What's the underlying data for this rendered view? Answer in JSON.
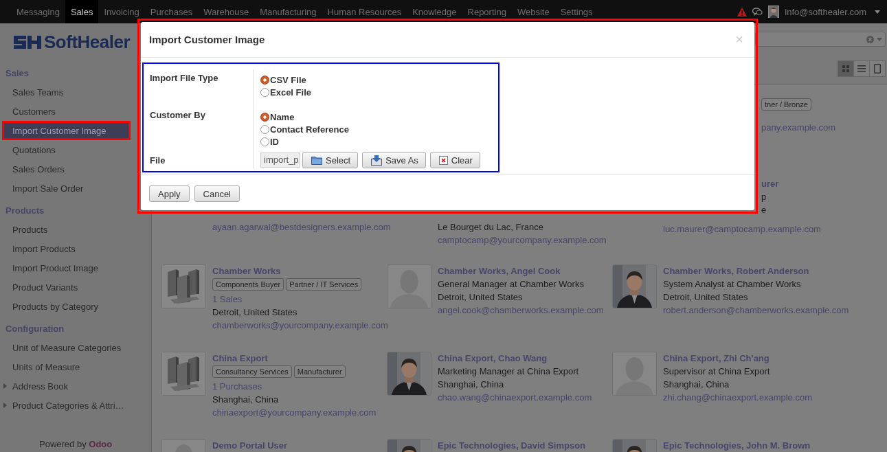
{
  "menu": [
    {
      "label": "Messaging",
      "selected": false
    },
    {
      "label": "Sales",
      "selected": true
    },
    {
      "label": "Invoicing",
      "selected": false
    },
    {
      "label": "Purchases",
      "selected": false
    },
    {
      "label": "Warehouse",
      "selected": false
    },
    {
      "label": "Manufacturing",
      "selected": false
    },
    {
      "label": "Human Resources",
      "selected": false
    },
    {
      "label": "Knowledge",
      "selected": false
    },
    {
      "label": "Reporting",
      "selected": false
    },
    {
      "label": "Website",
      "selected": false
    },
    {
      "label": "Settings",
      "selected": false
    }
  ],
  "user": {
    "email": "info@softhealer.com"
  },
  "sidebar": {
    "logo": "SoftHealer",
    "sections": [
      {
        "title": "Sales",
        "items": [
          {
            "label": "Sales Teams",
            "selected": false
          },
          {
            "label": "Customers",
            "selected": false
          },
          {
            "label": "Import Customer Image",
            "selected": true,
            "highlighted": true
          },
          {
            "label": "Quotations",
            "selected": false
          },
          {
            "label": "Sales Orders",
            "selected": false
          },
          {
            "label": "Import Sale Order",
            "selected": false
          }
        ]
      },
      {
        "title": "Products",
        "items": [
          {
            "label": "Products",
            "selected": false
          },
          {
            "label": "Import Products",
            "selected": false
          },
          {
            "label": "Import Product Image",
            "selected": false
          },
          {
            "label": "Product Variants",
            "selected": false
          },
          {
            "label": "Products by Category",
            "selected": false
          }
        ]
      },
      {
        "title": "Configuration",
        "items": [
          {
            "label": "Unit of Measure Categories",
            "selected": false
          },
          {
            "label": "Units of Measure",
            "selected": false
          },
          {
            "label": "Address Book",
            "selected": false,
            "expanded": false
          },
          {
            "label": "Product Categories & Attri…",
            "selected": false,
            "expanded": false
          }
        ]
      }
    ],
    "footer": "Powered by **Odoo**"
  },
  "views": [
    {
      "kind": "kanban",
      "selected": true
    },
    {
      "kind": "list",
      "selected": false
    },
    {
      "kind": "form",
      "selected": false
    }
  ],
  "rows": [
    {
      "cards": [
        {
          "kind": "covered",
          "side_lines": [
            {
              "kind": "tags",
              "tags": [
                "tner / Bronze"
              ]
            },
            {
              "kind": "link",
              "text": "pany.example.com"
            }
          ]
        }
      ]
    },
    {
      "cards": [
        {
          "kind": "covered",
          "lines": [
            {
              "kind": "link",
              "text": "ayaan.agarwal@bestdesigners.example.com"
            }
          ]
        },
        {
          "kind": "covered",
          "lines": [
            {
              "kind": "text",
              "text": "Le Bourget du Lac, France"
            },
            {
              "kind": "link",
              "text": "camptocamp@yourcompany.example.com"
            }
          ]
        },
        {
          "kind": "covered",
          "side_lines": [
            {
              "kind": "name",
              "text": "urer"
            },
            {
              "kind": "text",
              "text": "p"
            },
            {
              "kind": "text",
              "text": "e"
            }
          ],
          "lines": [
            {
              "kind": "link",
              "text": "luc.maurer@camptocamp.example.com"
            }
          ]
        }
      ]
    },
    {
      "cards": [
        {
          "kind": "company",
          "lines": [
            {
              "kind": "name",
              "text": "Chamber Works"
            },
            {
              "kind": "tags",
              "tags": [
                "Components Buyer",
                "Partner / IT Services"
              ]
            },
            {
              "kind": "link",
              "text": "1 Sales"
            },
            {
              "kind": "text",
              "text": "Detroit, United States"
            },
            {
              "kind": "link",
              "text": "chamberworks@yourcompany.example.com"
            }
          ]
        },
        {
          "kind": "contact",
          "lines": [
            {
              "kind": "name",
              "text": "Chamber Works, Angel Cook"
            },
            {
              "kind": "text",
              "text": "General Manager at Chamber Works"
            },
            {
              "kind": "text",
              "text": "Detroit, United States"
            },
            {
              "kind": "link",
              "text": "angel.cook@chamberworks.example.com"
            }
          ]
        },
        {
          "lines": [
            {
              "kind": "name",
              "text": "Chamber Works, Robert Anderson"
            },
            {
              "kind": "text",
              "text": "System Analyst at Chamber Works"
            },
            {
              "kind": "text",
              "text": "Detroit, United States"
            },
            {
              "kind": "link",
              "text": "robert.anderson@chamberworks.example.com"
            }
          ]
        }
      ]
    },
    {
      "cards": [
        {
          "kind": "company",
          "lines": [
            {
              "kind": "name",
              "text": "China Export"
            },
            {
              "kind": "tags",
              "tags": [
                "Consultancy Services",
                "Manufacturer"
              ]
            },
            {
              "kind": "link",
              "text": "1 Purchases"
            },
            {
              "kind": "text",
              "text": "Shanghai, China"
            },
            {
              "kind": "link",
              "text": "chinaexport@yourcompany.example.com"
            }
          ]
        },
        {
          "lines": [
            {
              "kind": "name",
              "text": "China Export, Chao Wang"
            },
            {
              "kind": "text",
              "text": "Marketing Manager at China Export"
            },
            {
              "kind": "text",
              "text": "Shanghai, China"
            },
            {
              "kind": "link",
              "text": "chao.wang@chinaexport.example.com"
            }
          ]
        },
        {
          "kind": "contact",
          "lines": [
            {
              "kind": "name",
              "text": "China Export, Zhi Ch'ang"
            },
            {
              "kind": "text",
              "text": "Supervisor at China Export"
            },
            {
              "kind": "text",
              "text": "Shanghai, China"
            },
            {
              "kind": "link",
              "text": "zhi.chang@chinaexport.example.com"
            }
          ]
        }
      ]
    },
    {
      "cards": [
        {
          "kind": "contact",
          "lines": [
            {
              "kind": "name",
              "text": "Demo Portal User"
            }
          ]
        },
        {
          "lines": [
            {
              "kind": "name",
              "text": "Epic Technologies, David Simpson"
            }
          ]
        },
        {
          "lines": [
            {
              "kind": "name",
              "text": "Epic Technologies, John M. Brown"
            }
          ]
        }
      ]
    }
  ],
  "dialog": {
    "title": "Import Customer Image",
    "close": "×",
    "highlighted": true,
    "form_outlined": true,
    "fields": [
      {
        "kind": "radio",
        "label": "Import File Type",
        "options": [
          {
            "label": "CSV File",
            "selected": true
          },
          {
            "label": "Excel File",
            "selected": false
          }
        ]
      },
      {
        "kind": "radio",
        "label": "Customer By",
        "options": [
          {
            "label": "Name",
            "selected": true
          },
          {
            "label": "Contact Reference",
            "selected": false
          },
          {
            "label": "ID",
            "selected": false
          }
        ]
      },
      {
        "kind": "file",
        "label": "File",
        "value": "import_p",
        "buttons": [
          {
            "kind": "select",
            "label": "Select"
          },
          {
            "kind": "save",
            "label": "Save As"
          },
          {
            "kind": "clear",
            "label": "Clear"
          }
        ]
      }
    ],
    "buttons": [
      "Apply",
      "Cancel"
    ]
  }
}
